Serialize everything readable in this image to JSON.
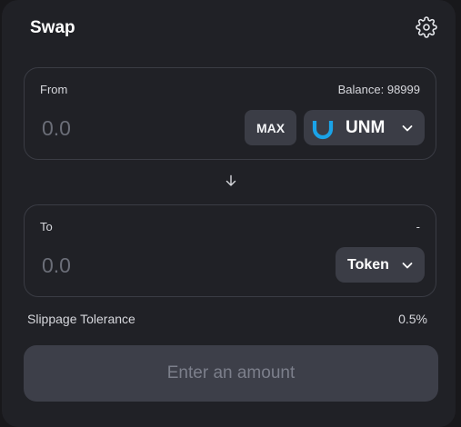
{
  "header": {
    "title": "Swap",
    "settings_icon": "gear-icon"
  },
  "from": {
    "label": "From",
    "balance_text": "Balance: 98999",
    "amount_placeholder": "0.0",
    "max_label": "MAX",
    "token": {
      "symbol": "UNM",
      "logo_icon": "unm-token-logo",
      "logo_color": "#1aa3e8"
    }
  },
  "switch_icon": "arrow-down-icon",
  "to": {
    "label": "To",
    "balance_text": "-",
    "amount_placeholder": "0.0",
    "token": {
      "symbol": "Token"
    }
  },
  "slippage": {
    "label": "Slippage Tolerance",
    "value": "0.5%"
  },
  "submit": {
    "label": "Enter an amount"
  },
  "colors": {
    "background": "#18181b",
    "card": "#202126",
    "button": "#3b3d46",
    "accent": "#1aa3e8"
  }
}
